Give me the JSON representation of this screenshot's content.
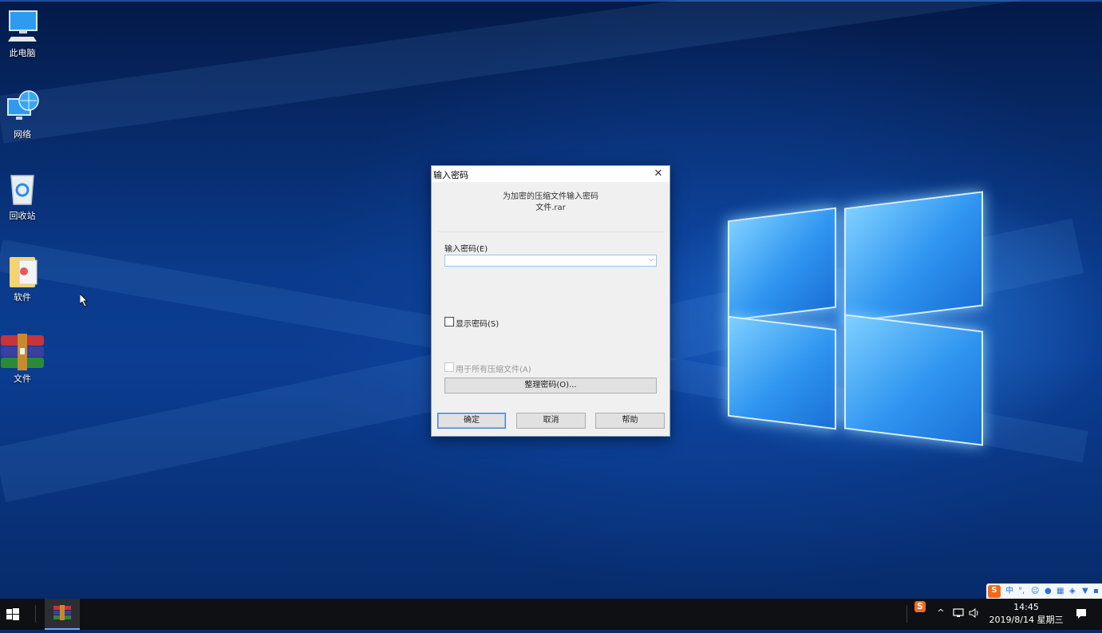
{
  "desktop": {
    "icons": [
      {
        "label": "此电脑",
        "icon": "computer-icon"
      },
      {
        "label": "网络",
        "icon": "network-icon"
      },
      {
        "label": "回收站",
        "icon": "recycle-bin-icon"
      },
      {
        "label": "软件",
        "icon": "folder-icon"
      },
      {
        "label": "文件",
        "icon": "winrar-archive-icon"
      }
    ]
  },
  "dialog": {
    "title": "输入密码",
    "close_symbol": "✕",
    "description_line1": "为加密的压缩文件输入密码",
    "description_line2": "文件.rar",
    "password_label": "输入密码(E)",
    "password_value": "",
    "show_password_label": "显示密码(S)",
    "show_password_checked": false,
    "use_for_all_label": "用于所有压缩文件(A)",
    "use_for_all_enabled": false,
    "organize_button": "整理密码(O)...",
    "ok_button": "确定",
    "cancel_button": "取消",
    "help_button": "帮助"
  },
  "taskbar": {
    "time": "14:45",
    "date": "2019/8/14 星期三",
    "tray_chevron": "^",
    "volume_symbol": "🔈",
    "notification_symbol": "🗨"
  },
  "ime_bar": {
    "logo": "S",
    "mode": "中",
    "punct": "°,"
  },
  "colors": {
    "wallpaper": "#0b3d92",
    "accent": "#3c7fd0",
    "taskbar": "#0e1013"
  }
}
